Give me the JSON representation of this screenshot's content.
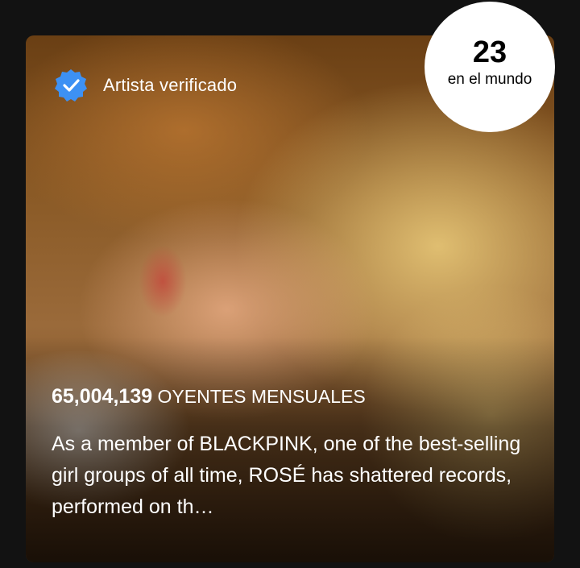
{
  "artist_card": {
    "verified_label": "Artista verificado",
    "verified_icon": "verified-badge-icon",
    "accent_color": "#3d91f4",
    "rank": {
      "number": "23",
      "label": "en el mundo"
    },
    "listeners": {
      "count": "65,004,139",
      "label": "OYENTES MENSUALES"
    },
    "bio": "As a member of BLACKPINK, one of the best-selling girl groups of all time, ROSÉ has shattered records, performed on th…"
  }
}
